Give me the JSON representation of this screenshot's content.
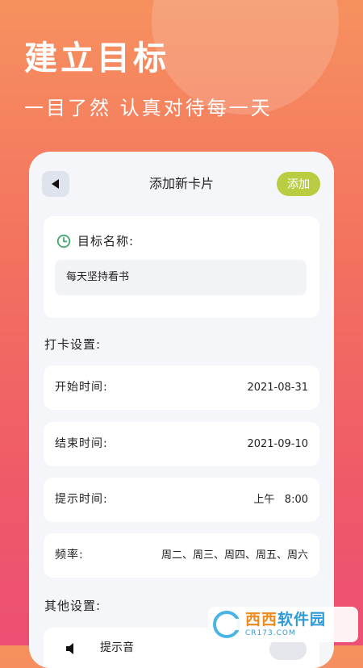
{
  "hero": {
    "title": "建立目标",
    "subtitle": "一目了然 认真对待每一天"
  },
  "topbar": {
    "title": "添加新卡片",
    "add_label": "添加",
    "back_icon": "back-arrow-icon"
  },
  "goal": {
    "label": "目标名称:",
    "value": "每天坚持看书",
    "icon": "clock-icon"
  },
  "checkin": {
    "section_title": "打卡设置:",
    "start_label": "开始时间:",
    "start_value": "2021-08-31",
    "end_label": "结束时间:",
    "end_value": "2021-09-10",
    "remind_label": "提示时间:",
    "remind_value": "上午   8:00",
    "freq_label": "频率:",
    "freq_value": "周二、周三、周四、周五、周六"
  },
  "other": {
    "section_title": "其他设置:",
    "reminder_label": "提示音"
  },
  "watermark": {
    "name_part1": "西西",
    "name_part2": "软件园",
    "url": "CR173.COM"
  },
  "colors": {
    "accent_green": "#b9cc42",
    "clock_icon": "#3faa6b",
    "card_bg": "#ffffff",
    "panel_bg": "#f5f6fa"
  }
}
